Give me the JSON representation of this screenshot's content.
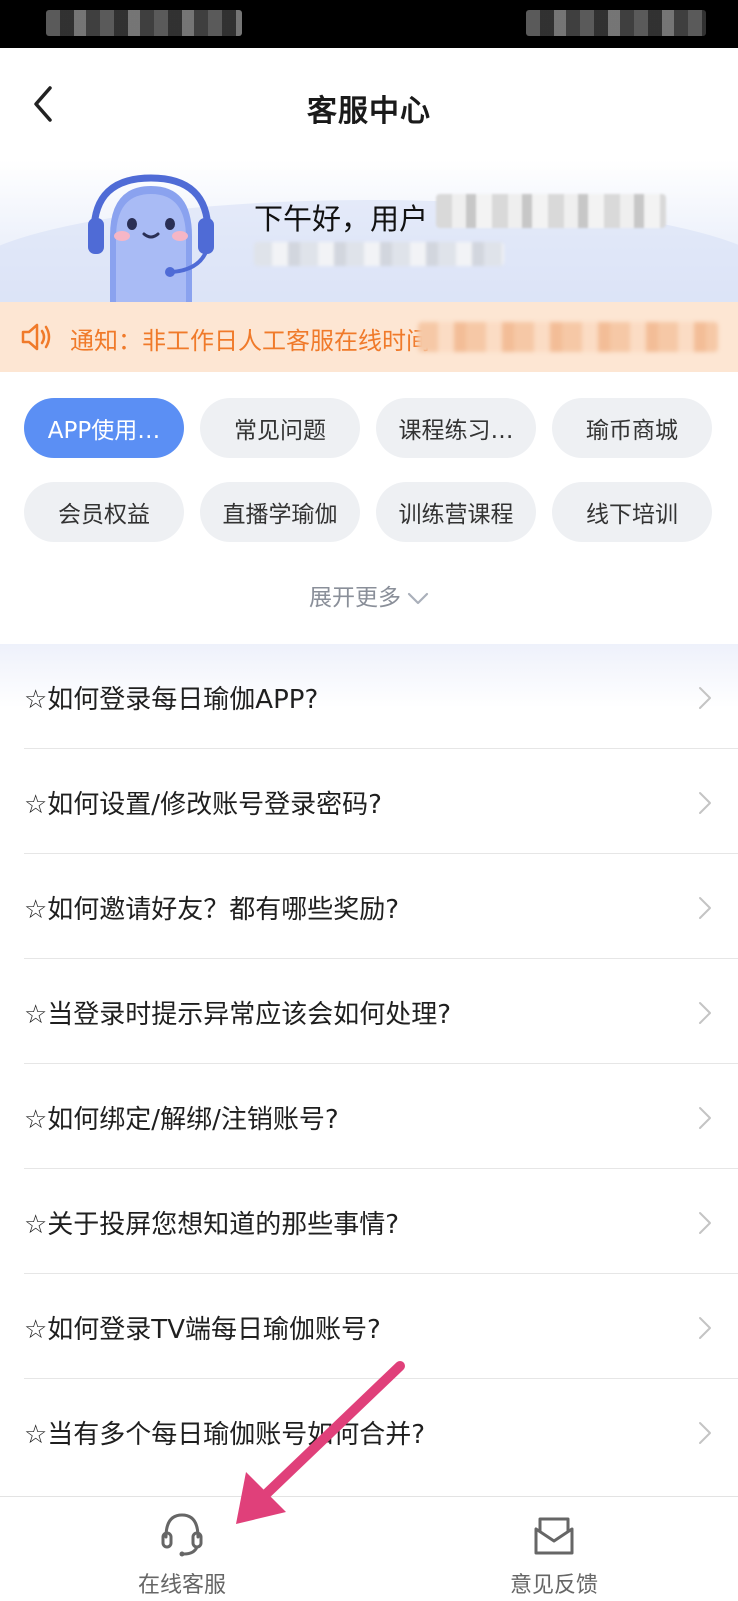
{
  "header": {
    "title": "客服中心"
  },
  "hero": {
    "greeting": "下午好，用户"
  },
  "notice": {
    "text": "通知：非工作日人工客服在线时间"
  },
  "categories": [
    {
      "label": "APP使用…",
      "active": true
    },
    {
      "label": "常见问题"
    },
    {
      "label": "课程练习…"
    },
    {
      "label": "瑜币商城"
    },
    {
      "label": "会员权益"
    },
    {
      "label": "直播学瑜伽"
    },
    {
      "label": "训练营课程"
    },
    {
      "label": "线下培训"
    }
  ],
  "expand_label": "展开更多",
  "faq": [
    {
      "text": "☆如何登录每日瑜伽APP?"
    },
    {
      "text": "☆如何设置/修改账号登录密码?"
    },
    {
      "text": "☆如何邀请好友？都有哪些奖励?"
    },
    {
      "text": "☆当登录时提示异常应该会如何处理?"
    },
    {
      "text": "☆如何绑定/解绑/注销账号?"
    },
    {
      "text": "☆关于投屏您想知道的那些事情?"
    },
    {
      "text": "☆如何登录TV端每日瑜伽账号?"
    },
    {
      "text": "☆当有多个每日瑜伽账号如何合并?"
    }
  ],
  "tabbar": {
    "online_service": "在线客服",
    "feedback": "意见反馈"
  },
  "colors": {
    "accent": "#5b8ff4",
    "notice_bg": "#fde6d3",
    "notice_text": "#f07a2a",
    "annotation_arrow": "#e0407a"
  },
  "icons": {
    "back": "chevron-left-icon",
    "notice": "speaker-icon",
    "expand": "chevron-down-icon",
    "row": "chevron-right-icon",
    "online_service": "headset-icon",
    "feedback": "mail-icon"
  }
}
